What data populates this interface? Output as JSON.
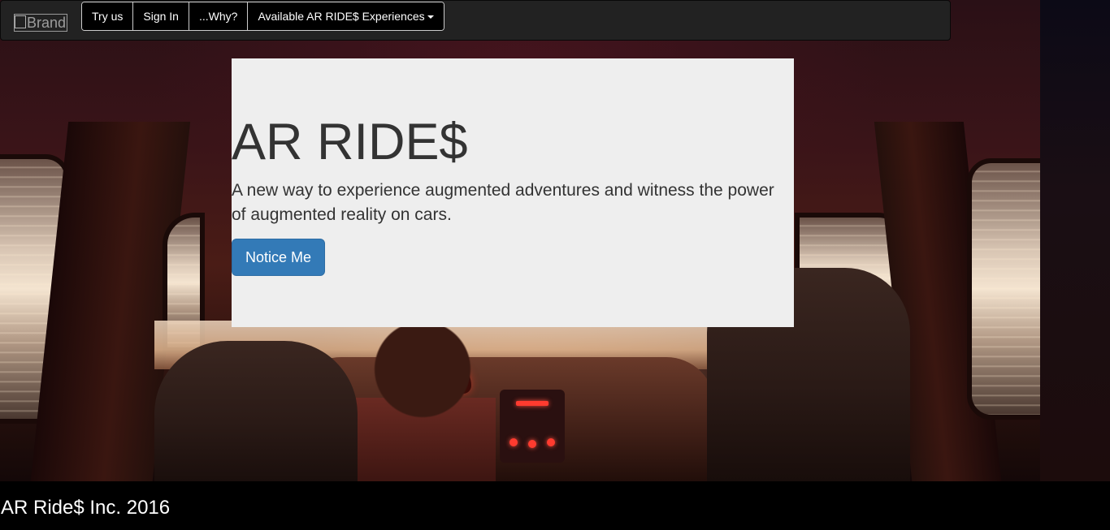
{
  "navbar": {
    "brand_alt": "Brand",
    "items": [
      {
        "label": "Try us"
      },
      {
        "label": "Sign In"
      },
      {
        "label": "...Why?"
      },
      {
        "label": "Available AR RIDE$ Experiences"
      }
    ]
  },
  "hero": {
    "title": "AR RIDE$",
    "description": "A new way to experience augmented adventures and witness the power of augmented reality on cars.",
    "cta_label": "Notice Me"
  },
  "footer": {
    "text": "AR Ride$ Inc. 2016"
  },
  "colors": {
    "navbar_bg": "#222222",
    "jumbotron_bg": "#eeeeee",
    "primary_button": "#337ab7",
    "footer_bg": "#000000"
  },
  "icons": {
    "dropdown": "caret-down-icon",
    "brand": "broken-image-icon"
  }
}
